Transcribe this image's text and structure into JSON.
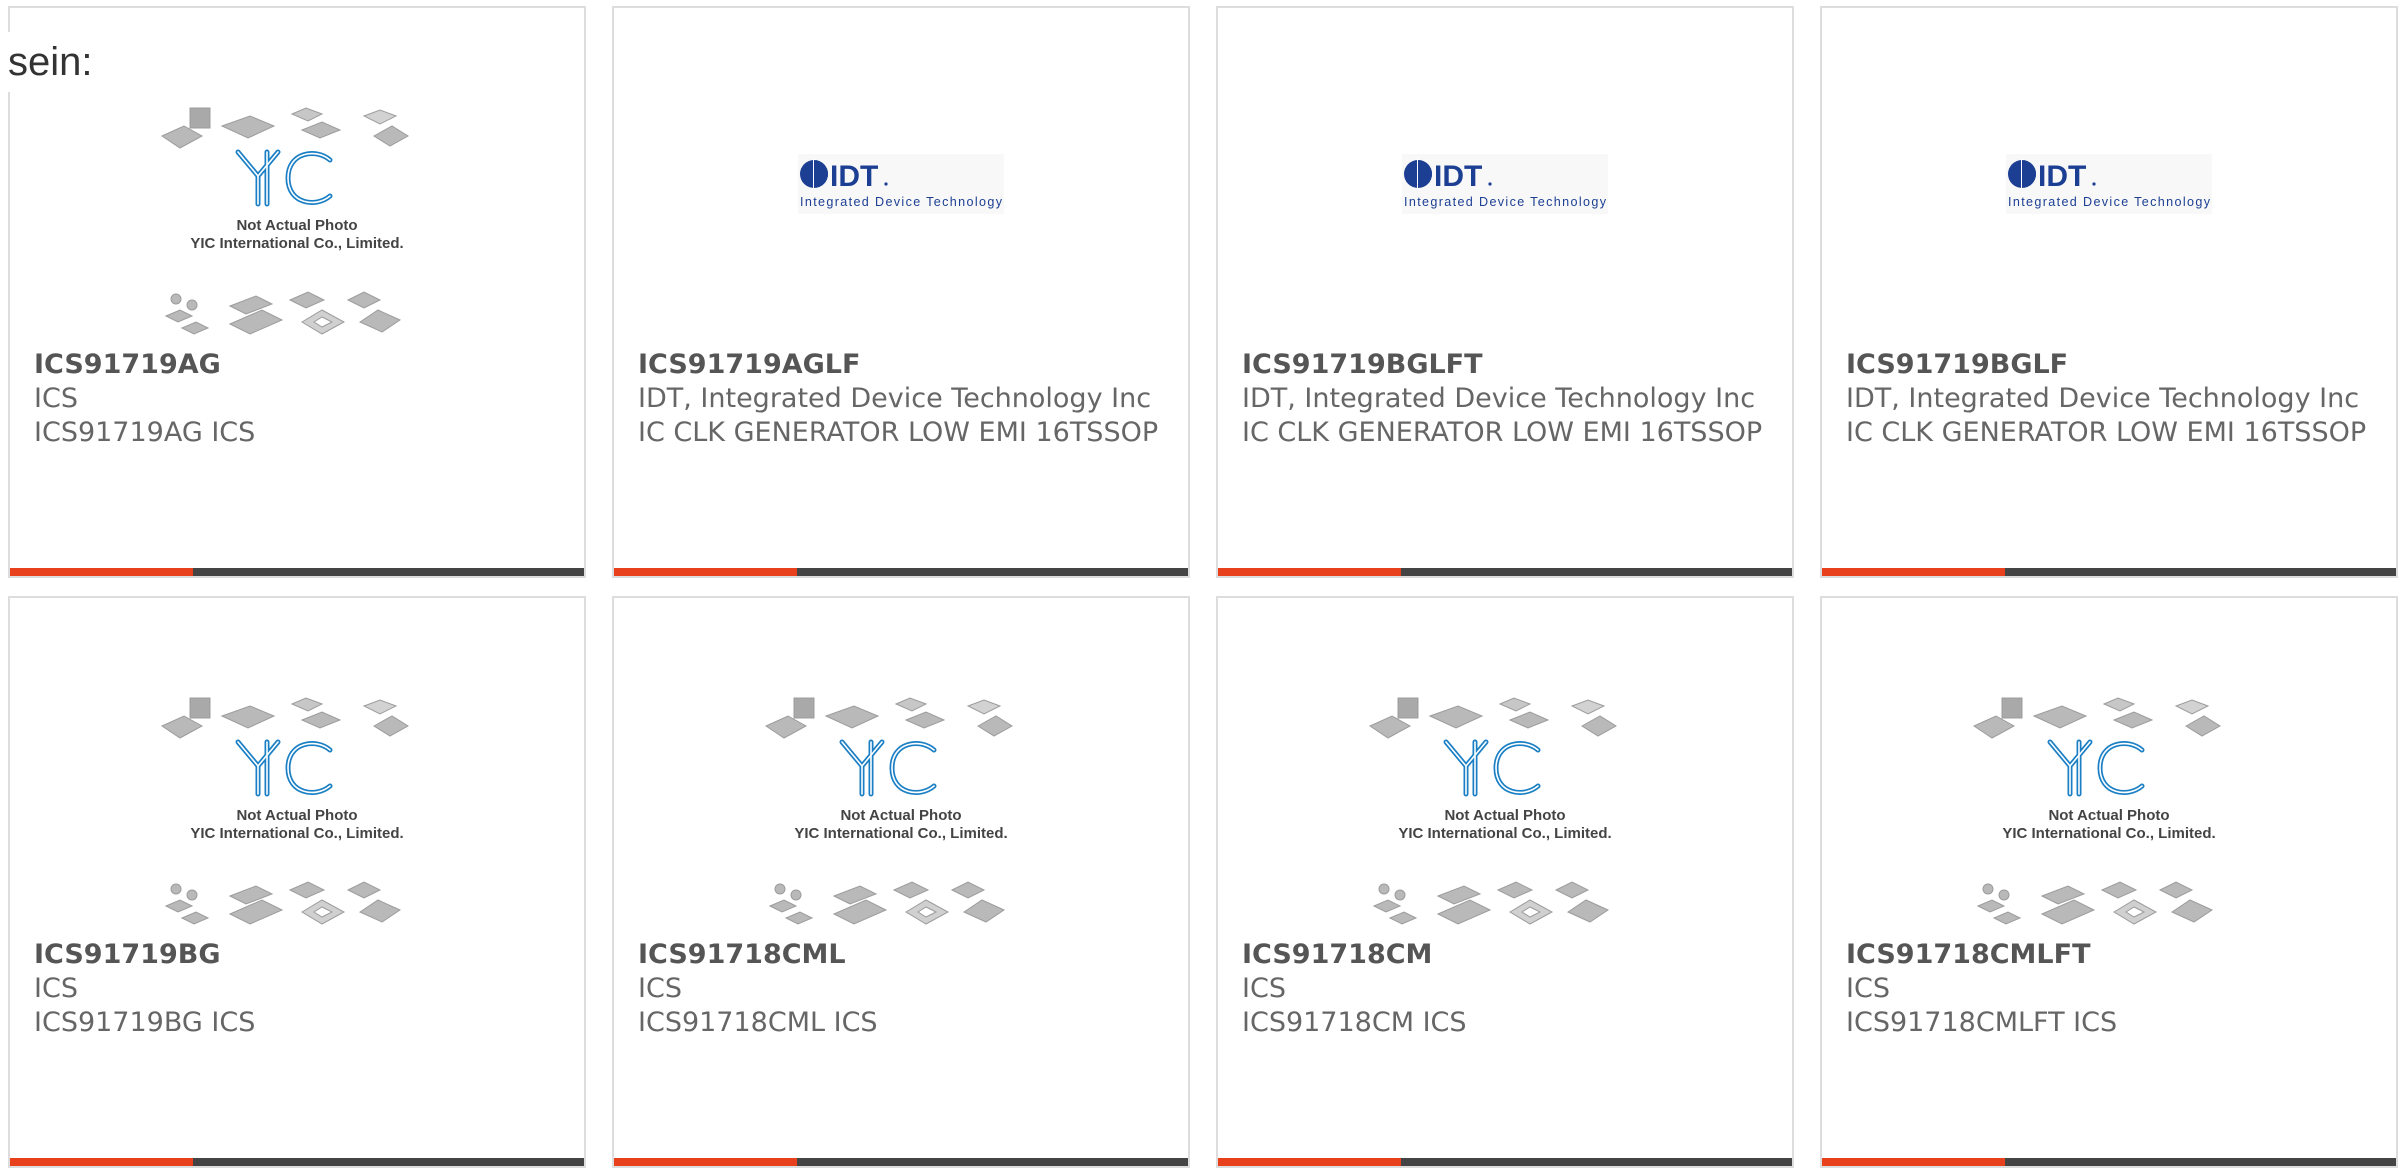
{
  "intro_text": "sein:",
  "placeholder": {
    "logo_text": "YIC",
    "line1": "Not Actual Photo",
    "line2": "YIC International Co., Limited."
  },
  "idt_logo": {
    "brand": "IDT",
    "tagline": "Integrated Device Technology"
  },
  "colors": {
    "accent": "#e8401c",
    "bar": "#444444",
    "border": "#dddddd",
    "text": "#666666",
    "yic_blue": "#1a7fc4"
  },
  "products": [
    {
      "part": "ICS91719AG",
      "manufacturer": "ICS",
      "description": "ICS91719AG ICS",
      "image": "yic-placeholder"
    },
    {
      "part": "ICS91719AGLF",
      "manufacturer": "IDT, Integrated Device Technology Inc",
      "description": "IC CLK GENERATOR LOW EMI 16TSSOP",
      "image": "idt-logo"
    },
    {
      "part": "ICS91719BGLFT",
      "manufacturer": "IDT, Integrated Device Technology Inc",
      "description": "IC CLK GENERATOR LOW EMI 16TSSOP",
      "image": "idt-logo"
    },
    {
      "part": "ICS91719BGLF",
      "manufacturer": "IDT, Integrated Device Technology Inc",
      "description": "IC CLK GENERATOR LOW EMI 16TSSOP",
      "image": "idt-logo"
    },
    {
      "part": "ICS91719BG",
      "manufacturer": "ICS",
      "description": "ICS91719BG ICS",
      "image": "yic-placeholder"
    },
    {
      "part": "ICS91718CML",
      "manufacturer": "ICS",
      "description": "ICS91718CML ICS",
      "image": "yic-placeholder"
    },
    {
      "part": "ICS91718CM",
      "manufacturer": "ICS",
      "description": "ICS91718CM ICS",
      "image": "yic-placeholder"
    },
    {
      "part": "ICS91718CMLFT",
      "manufacturer": "ICS",
      "description": "ICS91718CMLFT ICS",
      "image": "yic-placeholder"
    }
  ]
}
